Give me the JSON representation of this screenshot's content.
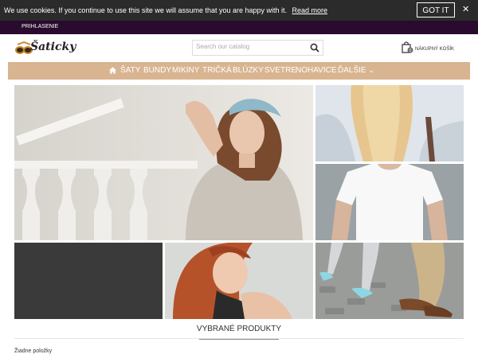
{
  "cookie": {
    "message": "We use cookies. If you continue to use this site we will assume that you are happy with it.",
    "read_more": "Read more",
    "got_it": "GOT IT",
    "close": "✕"
  },
  "topbar": {
    "login": "PRIHLASENIE"
  },
  "header": {
    "logo_text": "Šaticky",
    "search_placeholder": "Search our catalog",
    "cart_label": "NÁKUPNÝ KOŠÍK"
  },
  "nav": {
    "items": [
      "ŠATY",
      "BUNDY",
      "MIKINY",
      "TRIČKÁ",
      "BLÚZKY",
      "SVETRE",
      "NOHAVICE",
      "ĎALŠIE"
    ],
    "more_arrow": "⌄"
  },
  "featured": {
    "title": "VYBRANÉ PRODUKTY",
    "empty": "Žiadne položky"
  },
  "colors": {
    "nav_bg": "#d9b491",
    "topbar_bg": "#2a0a2e",
    "cookie_bg": "#2b2b2b"
  }
}
